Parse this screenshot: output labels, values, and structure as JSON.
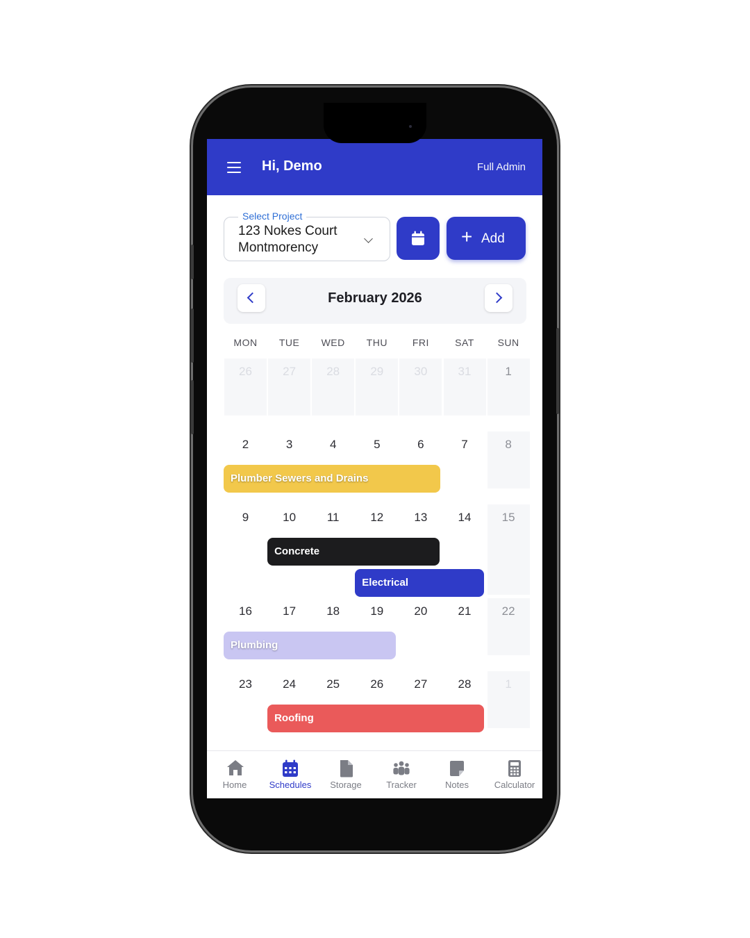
{
  "header": {
    "greeting": "Hi, Demo",
    "role": "Full Admin"
  },
  "project": {
    "label": "Select Project",
    "line1": "123 Nokes Court",
    "line2": "Montmorency"
  },
  "actions": {
    "add_label": "Add"
  },
  "calendar": {
    "month_title": "February 2026",
    "weekdays": [
      "MON",
      "TUE",
      "WED",
      "THU",
      "FRI",
      "SAT",
      "SUN"
    ],
    "weeks": [
      [
        "26",
        "27",
        "28",
        "29",
        "30",
        "31",
        "1"
      ],
      [
        "2",
        "3",
        "4",
        "5",
        "6",
        "7",
        "8"
      ],
      [
        "9",
        "10",
        "11",
        "12",
        "13",
        "14",
        "15"
      ],
      [
        "16",
        "17",
        "18",
        "19",
        "20",
        "21",
        "22"
      ],
      [
        "23",
        "24",
        "25",
        "26",
        "27",
        "28",
        "1"
      ]
    ],
    "events": [
      {
        "title": "Plumber Sewers and Drains",
        "start": "2026-02-02",
        "end": "2026-02-06",
        "color": "#f2c84b"
      },
      {
        "title": "Concrete",
        "start": "2026-02-10",
        "end": "2026-02-13",
        "color": "#1c1c1e"
      },
      {
        "title": "Electrical",
        "start": "2026-02-12",
        "end": "2026-02-14",
        "color": "#2f3bc8"
      },
      {
        "title": "Plumbing",
        "start": "2026-02-16",
        "end": "2026-02-19",
        "color": "#c9c6f2"
      },
      {
        "title": "Roofing",
        "start": "2026-02-24",
        "end": "2026-02-28",
        "color": "#ea5a5a"
      }
    ]
  },
  "tabs": [
    {
      "label": "Home",
      "icon": "home-icon"
    },
    {
      "label": "Schedules",
      "icon": "calendar-icon"
    },
    {
      "label": "Storage",
      "icon": "file-icon"
    },
    {
      "label": "Tracker",
      "icon": "people-icon"
    },
    {
      "label": "Notes",
      "icon": "note-icon"
    },
    {
      "label": "Calculator",
      "icon": "calculator-icon"
    }
  ],
  "colors": {
    "primary": "#2f3bc8",
    "label_blue": "#2f6fd6"
  }
}
